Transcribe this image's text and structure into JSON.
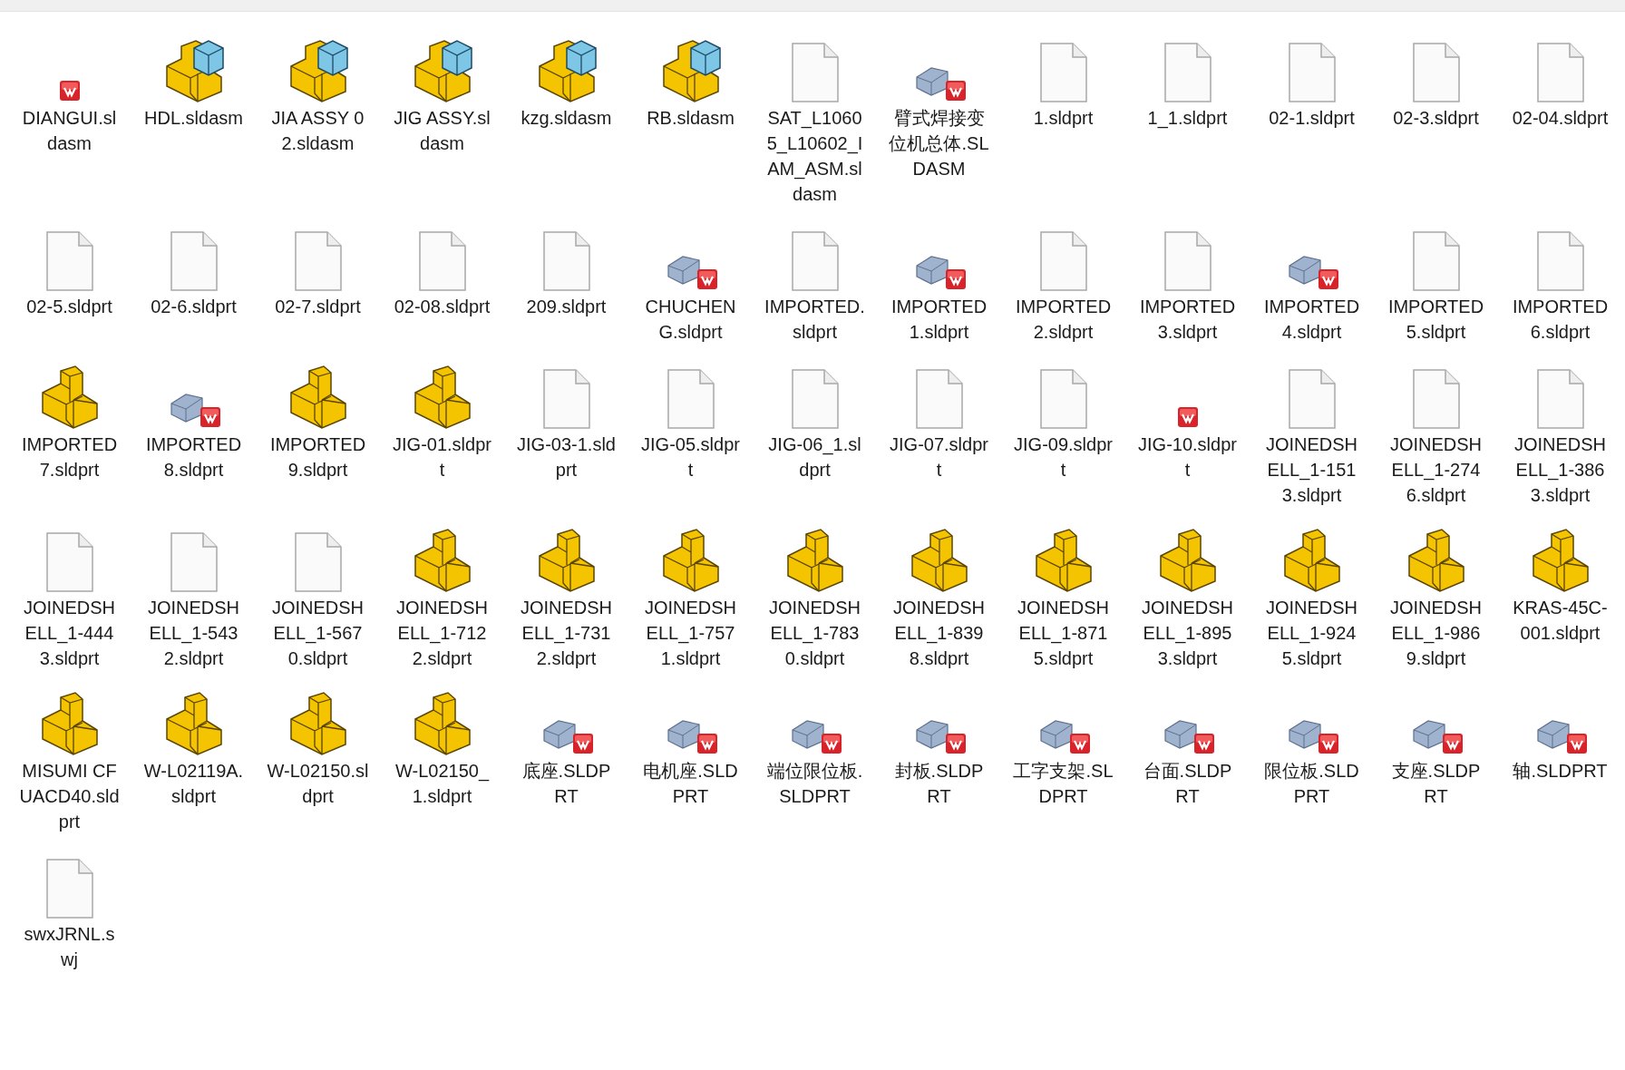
{
  "files": [
    {
      "name": "DIANGUI.sldasm",
      "kind": "badge"
    },
    {
      "name": "HDL.sldasm",
      "kind": "assembly"
    },
    {
      "name": "JIA ASSY 02.sldasm",
      "kind": "assembly"
    },
    {
      "name": "JIG ASSY.sldasm",
      "kind": "assembly"
    },
    {
      "name": "kzg.sldasm",
      "kind": "assembly"
    },
    {
      "name": "RB.sldasm",
      "kind": "assembly"
    },
    {
      "name": "SAT_L10605_L10602_IAM_ASM.sldasm",
      "kind": "document"
    },
    {
      "name": "臂式焊接变位机总体.SLDASM",
      "kind": "preview"
    },
    {
      "name": "1.sldprt",
      "kind": "document"
    },
    {
      "name": "1_1.sldprt",
      "kind": "document"
    },
    {
      "name": "02-1.sldprt",
      "kind": "document"
    },
    {
      "name": "02-3.sldprt",
      "kind": "document"
    },
    {
      "name": "02-04.sldprt",
      "kind": "document"
    },
    {
      "name": "02-5.sldprt",
      "kind": "document"
    },
    {
      "name": "02-6.sldprt",
      "kind": "document"
    },
    {
      "name": "02-7.sldprt",
      "kind": "document"
    },
    {
      "name": "02-08.sldprt",
      "kind": "document"
    },
    {
      "name": "209.sldprt",
      "kind": "document"
    },
    {
      "name": "CHUCHENG.sldprt",
      "kind": "preview"
    },
    {
      "name": "IMPORTED.sldprt",
      "kind": "document"
    },
    {
      "name": "IMPORTED1.sldprt",
      "kind": "preview"
    },
    {
      "name": "IMPORTED2.sldprt",
      "kind": "document"
    },
    {
      "name": "IMPORTED3.sldprt",
      "kind": "document"
    },
    {
      "name": "IMPORTED4.sldprt",
      "kind": "preview"
    },
    {
      "name": "IMPORTED5.sldprt",
      "kind": "document"
    },
    {
      "name": "IMPORTED6.sldprt",
      "kind": "document"
    },
    {
      "name": "IMPORTED7.sldprt",
      "kind": "part"
    },
    {
      "name": "IMPORTED8.sldprt",
      "kind": "preview"
    },
    {
      "name": "IMPORTED9.sldprt",
      "kind": "part"
    },
    {
      "name": "JIG-01.sldprt",
      "kind": "part"
    },
    {
      "name": "JIG-03-1.sldprt",
      "kind": "document"
    },
    {
      "name": "JIG-05.sldprt",
      "kind": "document"
    },
    {
      "name": "JIG-06_1.sldprt",
      "kind": "document"
    },
    {
      "name": "JIG-07.sldprt",
      "kind": "document"
    },
    {
      "name": "JIG-09.sldprt",
      "kind": "document"
    },
    {
      "name": "JIG-10.sldprt",
      "kind": "badge"
    },
    {
      "name": "JOINEDSHELL_1-1513.sldprt",
      "kind": "document"
    },
    {
      "name": "JOINEDSHELL_1-2746.sldprt",
      "kind": "document"
    },
    {
      "name": "JOINEDSHELL_1-3863.sldprt",
      "kind": "document"
    },
    {
      "name": "JOINEDSHELL_1-4443.sldprt",
      "kind": "document"
    },
    {
      "name": "JOINEDSHELL_1-5432.sldprt",
      "kind": "document"
    },
    {
      "name": "JOINEDSHELL_1-5670.sldprt",
      "kind": "document"
    },
    {
      "name": "JOINEDSHELL_1-7122.sldprt",
      "kind": "part"
    },
    {
      "name": "JOINEDSHELL_1-7312.sldprt",
      "kind": "part"
    },
    {
      "name": "JOINEDSHELL_1-7571.sldprt",
      "kind": "part"
    },
    {
      "name": "JOINEDSHELL_1-7830.sldprt",
      "kind": "part"
    },
    {
      "name": "JOINEDSHELL_1-8398.sldprt",
      "kind": "part"
    },
    {
      "name": "JOINEDSHELL_1-8715.sldprt",
      "kind": "part"
    },
    {
      "name": "JOINEDSHELL_1-8953.sldprt",
      "kind": "part"
    },
    {
      "name": "JOINEDSHELL_1-9245.sldprt",
      "kind": "part"
    },
    {
      "name": "JOINEDSHELL_1-9869.sldprt",
      "kind": "part"
    },
    {
      "name": "KRAS-45C-001.sldprt",
      "kind": "part"
    },
    {
      "name": "MISUMI CFUACD40.sldprt",
      "kind": "part"
    },
    {
      "name": "W-L02119A.sldprt",
      "kind": "part"
    },
    {
      "name": "W-L02150.sldprt",
      "kind": "part"
    },
    {
      "name": "W-L02150_1.sldprt",
      "kind": "part"
    },
    {
      "name": "底座.SLDPRT",
      "kind": "preview"
    },
    {
      "name": "电机座.SLDPRT",
      "kind": "preview"
    },
    {
      "name": "端位限位板.SLDPRT",
      "kind": "preview"
    },
    {
      "name": "封板.SLDPRT",
      "kind": "preview"
    },
    {
      "name": "工字支架.SLDPRT",
      "kind": "preview"
    },
    {
      "name": "台面.SLDPRT",
      "kind": "preview"
    },
    {
      "name": "限位板.SLDPRT",
      "kind": "preview"
    },
    {
      "name": "支座.SLDPRT",
      "kind": "preview"
    },
    {
      "name": "轴.SLDPRT",
      "kind": "preview"
    },
    {
      "name": "swxJRNL.swj",
      "kind": "document"
    }
  ]
}
